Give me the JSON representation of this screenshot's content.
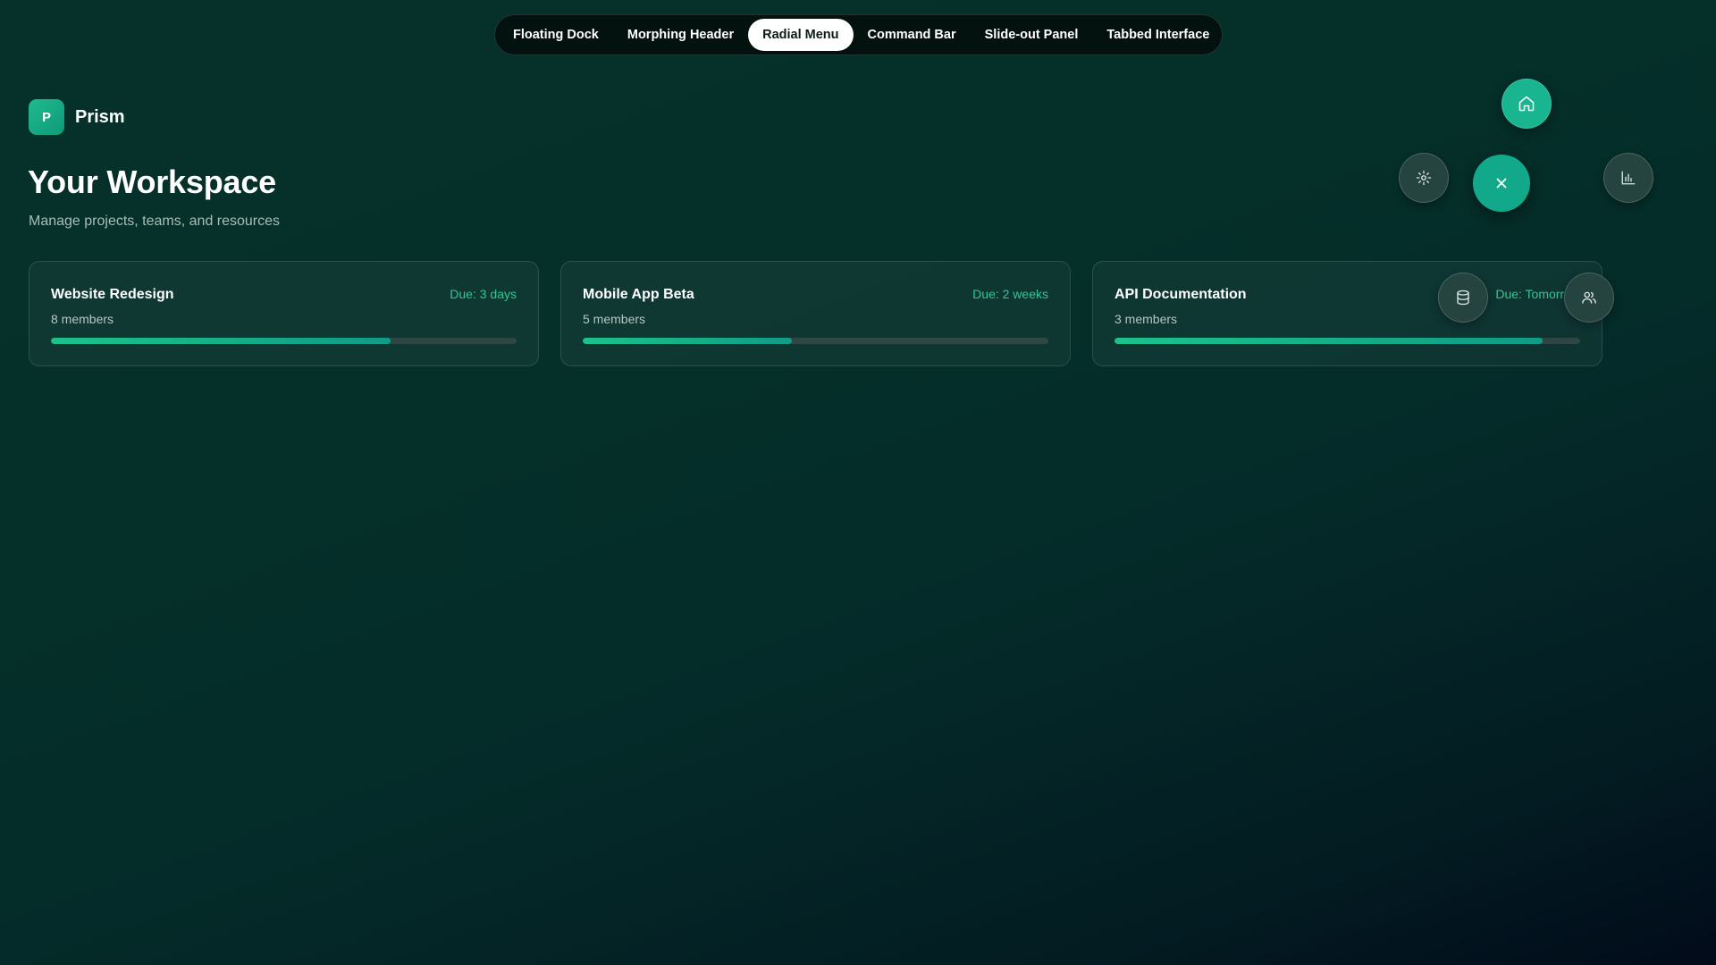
{
  "demo_nav": {
    "tabs": [
      {
        "label": "Floating Dock",
        "active": false
      },
      {
        "label": "Morphing Header",
        "active": false
      },
      {
        "label": "Radial Menu",
        "active": true
      },
      {
        "label": "Command Bar",
        "active": false
      },
      {
        "label": "Slide-out Panel",
        "active": false
      },
      {
        "label": "Tabbed Interface",
        "active": false
      }
    ]
  },
  "brand": {
    "logo_letter": "P",
    "name": "Prism"
  },
  "header": {
    "title": "Your Workspace",
    "subtitle": "Manage projects, teams, and resources"
  },
  "projects": [
    {
      "title": "Website Redesign",
      "members": "8 members",
      "due": "Due: 3 days",
      "progress": 0.73
    },
    {
      "title": "Mobile App Beta",
      "members": "5 members",
      "due": "Due: 2 weeks",
      "progress": 0.45
    },
    {
      "title": "API Documentation",
      "members": "3 members",
      "due": "Due: Tomorrow",
      "progress": 0.92
    }
  ],
  "radial_menu": {
    "open": true,
    "items": [
      {
        "icon": "home-icon"
      },
      {
        "icon": "settings-icon"
      },
      {
        "icon": "analytics-icon"
      },
      {
        "icon": "database-icon"
      },
      {
        "icon": "users-icon"
      }
    ],
    "toggle_icon": "close-icon"
  },
  "colors": {
    "accent": "#18b590",
    "due_text": "#2ec892",
    "background": "#05302a"
  }
}
